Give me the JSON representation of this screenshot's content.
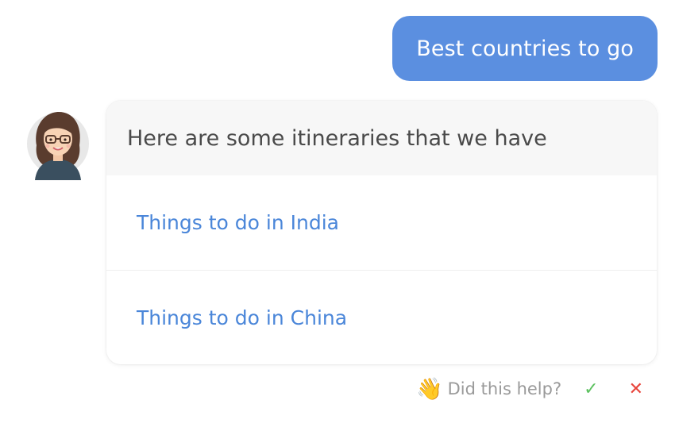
{
  "user_message": {
    "text": "Best countries to go"
  },
  "bot_message": {
    "text": "Here are some itineraries that we have",
    "options": [
      {
        "label": "Things to do in India"
      },
      {
        "label": "Things to do in China"
      }
    ]
  },
  "feedback": {
    "wave_emoji": "👋",
    "question": "Did this help?",
    "yes_icon": "✓",
    "no_icon": "✕"
  },
  "colors": {
    "user_bubble": "#5b8fe0",
    "link": "#4a86d9",
    "check": "#5cc15f",
    "cross": "#e8453c"
  },
  "icons": {
    "avatar": "avatar-woman-glasses",
    "yes": "checkmark-icon",
    "no": "close-icon"
  }
}
